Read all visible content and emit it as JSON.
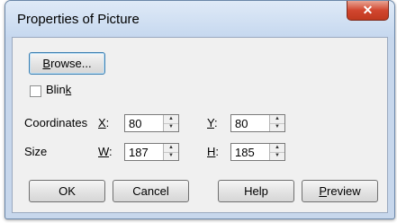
{
  "window": {
    "title": "Properties of Picture",
    "close_glyph": "✕"
  },
  "browse_button": {
    "label_accel": "B",
    "label_rest": "rowse..."
  },
  "blink": {
    "label_pre": "Blin",
    "label_accel": "k",
    "checked": false
  },
  "coordinates": {
    "label": "Coordinates",
    "x_label": "X",
    "x_value": "80",
    "y_label": "Y",
    "y_value": "80"
  },
  "size": {
    "label": "Size",
    "w_label": "W",
    "w_value": "187",
    "h_label": "H",
    "h_value": "185"
  },
  "buttons": {
    "ok": "OK",
    "cancel": "Cancel",
    "help": "Help",
    "preview_accel": "P",
    "preview_rest": "review"
  },
  "icons": {
    "spin_up": "up-triangle",
    "spin_down": "down-triangle",
    "close": "close-x"
  }
}
